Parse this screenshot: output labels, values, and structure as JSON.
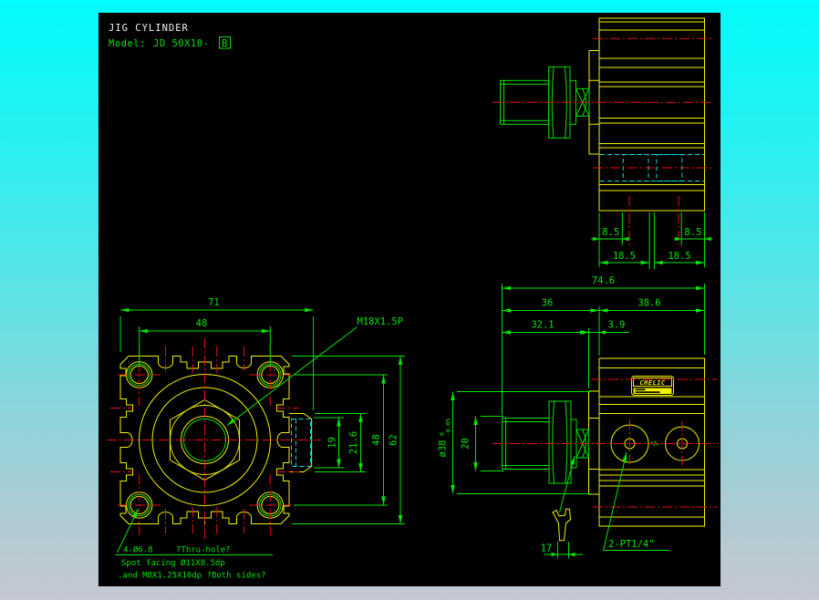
{
  "title_block": {
    "product": "JIG CYLINDER",
    "model_label": "Model:",
    "model_code": "JD 50X10-",
    "model_variant": "B"
  },
  "front_view": {
    "dim_width_total": "71",
    "dim_bolt_pitch_h": "48",
    "thread_label": "M18X1.5P",
    "dim_slot_inner": "19",
    "dim_slot_outer": "21.6",
    "dim_bolt_pitch_v": "48",
    "dim_height": "62",
    "note_hole": "4-Ø6.8",
    "note_hole_suffix": "?Thru-hole?",
    "note_spotface": "Spot facing Ø11X8.5dp",
    "note_thread": ".and M8X1.25X10dp ?Both sides?"
  },
  "top_view": {
    "dim_port_edge_left": "8.5",
    "dim_port_edge_right": "8.5",
    "dim_port_pitch_left": "18.5",
    "dim_port_pitch_right": "18.5"
  },
  "side_view": {
    "dim_overall": "74.6",
    "dim_front": "36",
    "dim_body_depth": "38.6",
    "dim_rod_extend": "32.1",
    "dim_boss_depth": "3.9",
    "dim_rod_dia": "20",
    "boss_dia": "ø38",
    "boss_tol_upper": "0",
    "boss_tol_lower": "-0.05",
    "dim_wrench_flats": "17",
    "port_label": "2-PT1/4\"",
    "sticker_brand": "CHELIC"
  },
  "colors": {
    "outline": "#f2f200",
    "dimension": "#00e400",
    "centerline": "#e81010",
    "hidden": "#00dede",
    "canvas": "#000000"
  }
}
